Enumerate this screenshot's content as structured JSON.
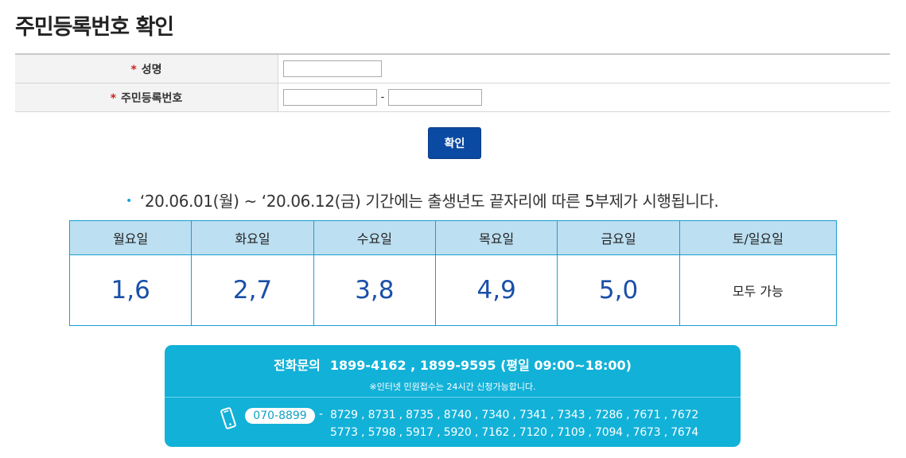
{
  "page": {
    "title": "주민등록번호 확인"
  },
  "form": {
    "required_mark": "*",
    "name_label": "성명",
    "ssn_label": "주민등록번호",
    "name_value": "",
    "ssn_first_value": "",
    "ssn_second_value": "",
    "separator": "-"
  },
  "confirm_button": {
    "label": "확인"
  },
  "notice": {
    "bullet": "•",
    "text": "‘20.06.01(월) ~ ‘20.06.12(금) 기간에는 출생년도 끝자리에 따른 5부제가 시행됩니다."
  },
  "schedule": {
    "days": [
      "월요일",
      "화요일",
      "수요일",
      "목요일",
      "금요일",
      "토/일요일"
    ],
    "digits": [
      "1,6",
      "2,7",
      "3,8",
      "4,9",
      "5,0",
      "모두 가능"
    ]
  },
  "contact": {
    "phone_label": "전화문의",
    "phone_numbers": "1899-4162 , 1899-9595 (평일 09:00~18:00)",
    "note": "※인터넷 민원접수는 24시간 신청가능합니다.",
    "main_number": "070-8899",
    "dash": "-",
    "extensions_line1": "8729 , 8731 , 8735 , 8740 , 7340 , 7341 , 7343 , 7286 , 7671 , 7672",
    "extensions_line2": "5773 , 5798 , 5917 , 5920 , 7162 , 7120 , 7109 , 7094 , 7673 , 7674",
    "icon": "mobile-phone-icon"
  },
  "colors": {
    "button": "#0b4aa2",
    "header_bg": "#bcdff1",
    "border": "#1a9fd0",
    "digits": "#1a4fa8",
    "contact_bg": "#12b1d8",
    "required": "#d21e1e"
  }
}
